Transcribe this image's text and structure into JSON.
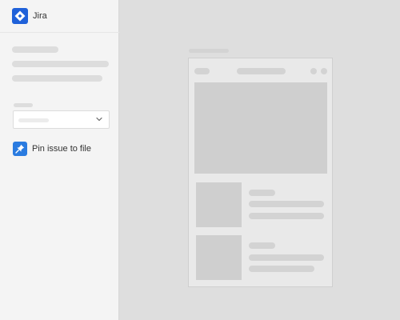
{
  "app": {
    "title": "Jira",
    "logo_icon": "jira-logo-icon",
    "brand_color": "#1f61d9"
  },
  "sidebar": {
    "select_icon": "chevron-down-icon",
    "pin_action": {
      "label": "Pin issue to file",
      "icon": "pin-icon",
      "color": "#2a7be0"
    }
  },
  "colors": {
    "sidebar_bg": "#f4f4f4",
    "canvas_bg": "#dedede",
    "placeholder": "#dddddd"
  }
}
